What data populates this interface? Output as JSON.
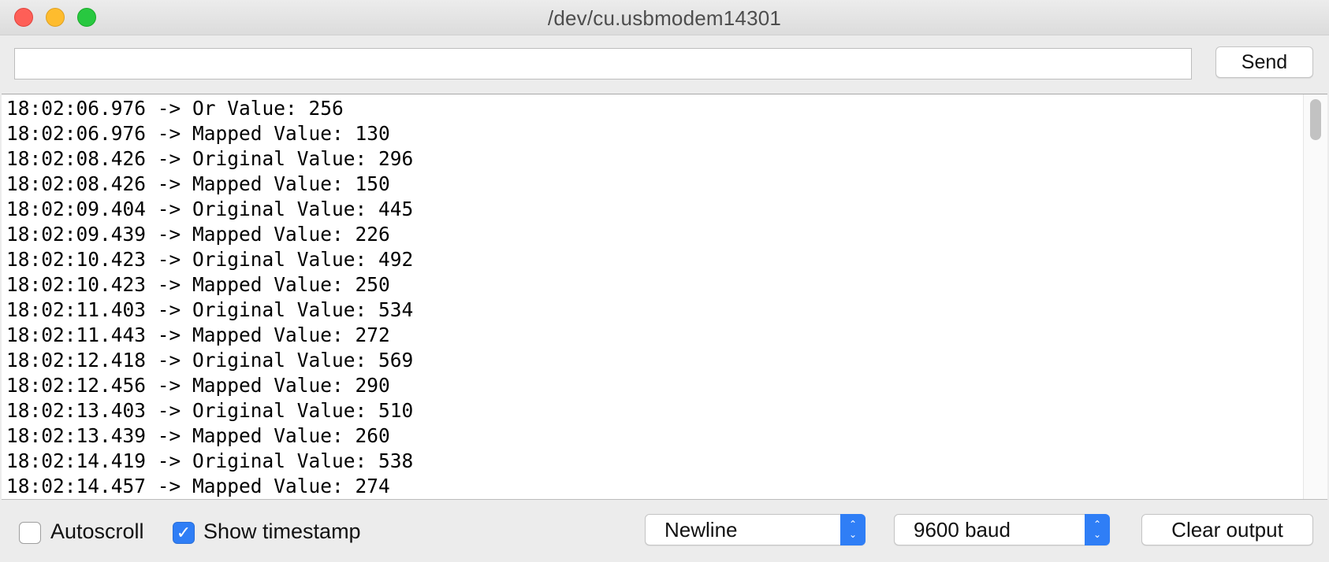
{
  "window": {
    "title": "/dev/cu.usbmodem14301"
  },
  "send": {
    "input_value": "",
    "button_label": "Send"
  },
  "output": {
    "lines": [
      "18:02:06.976 -> Or Value: 256",
      "18:02:06.976 -> Mapped Value: 130",
      "18:02:08.426 -> Original Value: 296",
      "18:02:08.426 -> Mapped Value: 150",
      "18:02:09.404 -> Original Value: 445",
      "18:02:09.439 -> Mapped Value: 226",
      "18:02:10.423 -> Original Value: 492",
      "18:02:10.423 -> Mapped Value: 250",
      "18:02:11.403 -> Original Value: 534",
      "18:02:11.443 -> Mapped Value: 272",
      "18:02:12.418 -> Original Value: 569",
      "18:02:12.456 -> Mapped Value: 290",
      "18:02:13.403 -> Original Value: 510",
      "18:02:13.439 -> Mapped Value: 260",
      "18:02:14.419 -> Original Value: 538",
      "18:02:14.457 -> Mapped Value: 274"
    ]
  },
  "controls": {
    "autoscroll": {
      "label": "Autoscroll",
      "checked": false
    },
    "show_timestamp": {
      "label": "Show timestamp",
      "checked": true,
      "check_glyph": "✓"
    },
    "line_ending": {
      "selected": "Newline"
    },
    "baud_rate": {
      "selected": "9600 baud"
    },
    "clear_button_label": "Clear output",
    "stepper_glyph_up": "⌃",
    "stepper_glyph_down": "⌄"
  },
  "colors": {
    "close": "#fe5f57",
    "minimize": "#febc2e",
    "maximize": "#28c840",
    "accent": "#2f7ef6"
  }
}
